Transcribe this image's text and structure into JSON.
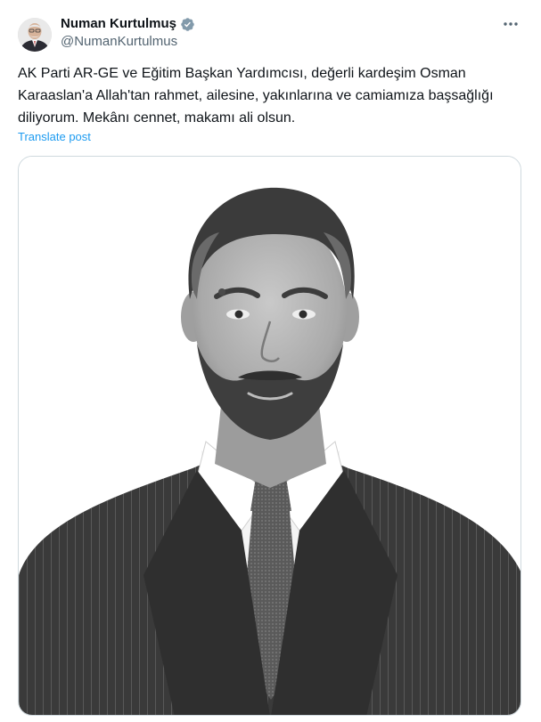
{
  "author": {
    "display_name": "Numan Kurtulmuş",
    "handle": "@NumanKurtulmus",
    "verified": true,
    "verified_color": "#829aab"
  },
  "tweet": {
    "text": "AK Parti AR-GE ve Eğitim Başkan Yardımcısı, değerli kardeşim Osman Karaaslan'a Allah'tan rahmet, ailesine, yakınlarına ve camiamıza başsağlığı diliyorum. Mekânı cennet, makamı ali olsun.",
    "translate_label": "Translate post"
  },
  "media": {
    "kind": "photo",
    "tone": "black-and-white portrait"
  },
  "icons": {
    "more": "more-horizontal-icon",
    "verified": "verified-badge-icon"
  },
  "colors": {
    "link": "#1d9bf0",
    "secondary_text": "#536471",
    "border": "#cfd9de"
  }
}
